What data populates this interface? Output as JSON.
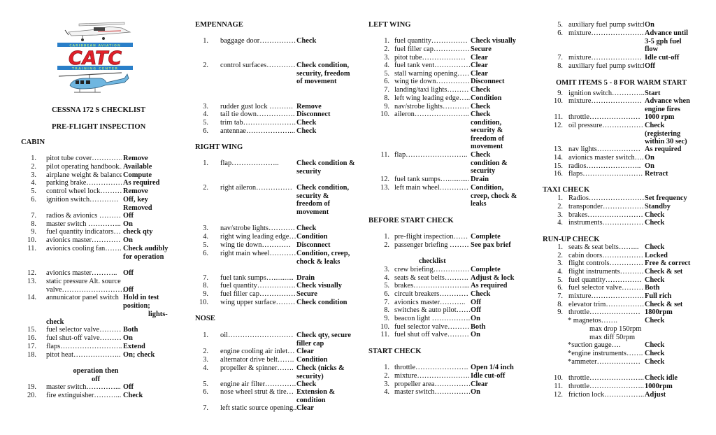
{
  "header": {
    "logo_top_text": "CARIBBEAN AVIATION",
    "logo_main_text": "CATC",
    "logo_bottom_text": "TRAINING CENTER",
    "logo_colors": {
      "red": "#e0202a",
      "blue": "#2a7fc9",
      "heli_blue": "#6fb6e0"
    },
    "title": "CESSNA 172 S CHECKLIST",
    "subtitle": "PRE-FLIGHT INSPECTION"
  },
  "cabin": {
    "title": "CABIN",
    "items": [
      {
        "n": "1.",
        "label": "pitot tube cover………….",
        "value": "Remove"
      },
      {
        "n": "2.",
        "label": "pilot operating handbook..",
        "value": "Available"
      },
      {
        "n": "3.",
        "label": "airplane weight & balance.",
        "value": "Compute"
      },
      {
        "n": "4.",
        "label": "parking brake……………",
        "value": "As required"
      },
      {
        "n": "5.",
        "label": "control wheel lock………",
        "value": "Remove"
      },
      {
        "n": "6.",
        "label": "ignition switch…………",
        "value": "Off, key Removed"
      },
      {
        "n": "7.",
        "label": "radios & avionics ………",
        "value": "Off"
      },
      {
        "n": "8.",
        "label": "master switch …………..",
        "value": "On"
      },
      {
        "n": "9.",
        "label": "fuel quantity indicators…",
        "value": "check qty"
      },
      {
        "n": "10.",
        "label": "avionics master…………",
        "value": "On"
      },
      {
        "n": "11.",
        "label": "avionics cooling fan…….",
        "value": "Check audibly for operation"
      },
      {
        "n": "12.",
        "label": "avionics master………..",
        "value": "Off"
      },
      {
        "n": "13.",
        "label": "static pressure Alt. source valve………………………",
        "value": "Off"
      },
      {
        "n": "14.",
        "label": "annunicator panel switch",
        "value": "Hold in test position;"
      },
      {
        "n": "15.",
        "label": "fuel selector valve……….",
        "value": "Both"
      },
      {
        "n": "16.",
        "label": "fuel shut-off valve………",
        "value": "On"
      },
      {
        "n": "17.",
        "label": "flaps……………………..",
        "value": "Extend"
      },
      {
        "n": "18.",
        "label": "pitot heat………………..",
        "value": "On; check"
      },
      {
        "n": "19.",
        "label": "master switch…………...",
        "value": "Off"
      },
      {
        "n": "20.",
        "label": "fire extinguisher………...",
        "value": "Check"
      }
    ],
    "item14_cont1": "lights-",
    "item14_cont2": "check",
    "item18_cont1": "operation then",
    "item18_cont2": "off"
  },
  "empennage": {
    "title": "EMPENNAGE",
    "items": [
      {
        "n": "1.",
        "label": "baggage door……………",
        "value": "Check"
      },
      {
        "n": "2.",
        "label": "control surfaces…………",
        "value": "Check condition, security, freedom of movement"
      },
      {
        "n": "3.",
        "label": "rudder gust lock ……….",
        "value": "Remove"
      },
      {
        "n": "4.",
        "label": "tail tie down…………….",
        "value": "Disconnect"
      },
      {
        "n": "5.",
        "label": "trim tab…………………..",
        "value": "Check"
      },
      {
        "n": "6.",
        "label": "antennae………………...",
        "value": "Check"
      }
    ]
  },
  "right_wing": {
    "title": "RIGHT WING",
    "items": [
      {
        "n": "1.",
        "label": "flap………………..",
        "value": "Check condition & security"
      },
      {
        "n": "2.",
        "label": "right aileron……………",
        "value": "Check condition, security & freedom of movement"
      },
      {
        "n": "3.",
        "label": "nav/strobe lights…………",
        "value": "Check"
      },
      {
        "n": "4.",
        "label": "right wing leading edge…",
        "value": "Condition"
      },
      {
        "n": "5.",
        "label": "wing tie down…………",
        "value": "Disconnect"
      },
      {
        "n": "6.",
        "label": "right main wheel…………",
        "value": "Condition, creep, chock & leaks"
      },
      {
        "n": "7.",
        "label": "fuel tank sumps…...........",
        "value": "Drain"
      },
      {
        "n": "8.",
        "label": "fuel quantity…………….",
        "value": "Check visually"
      },
      {
        "n": "9.",
        "label": "fuel filler cap…………….",
        "value": "Secure"
      },
      {
        "n": "10.",
        "label": "wing upper surface………",
        "value": "Check condition"
      }
    ]
  },
  "nose": {
    "title": "NOSE",
    "items": [
      {
        "n": "1.",
        "label": "oil………………………",
        "value": "Check qty, secure filler cap"
      },
      {
        "n": "2.",
        "label": "engine cooling air inlet…",
        "value": "Clear"
      },
      {
        "n": "3.",
        "label": "alternator drive belt…….",
        "value": "Condition"
      },
      {
        "n": "4.",
        "label": "propeller & spinner…….",
        "value": "Check (nicks & security)"
      },
      {
        "n": "5.",
        "label": "engine air filter………….",
        "value": "Check"
      },
      {
        "n": "6.",
        "label": "nose wheel strut & tire…",
        "value": "Extension & condition"
      },
      {
        "n": "7.",
        "label": "left static source opening...",
        "value": "Clear"
      }
    ]
  },
  "left_wing": {
    "title": "LEFT WING",
    "items": [
      {
        "n": "1.",
        "label": "fuel quantity……………",
        "value": "Check visually"
      },
      {
        "n": "2.",
        "label": "fuel filler cap……………",
        "value": "Secure"
      },
      {
        "n": "3.",
        "label": "pitot tube………………",
        "value": "Clear"
      },
      {
        "n": "4.",
        "label": "fuel tank vent……………",
        "value": "Clear"
      },
      {
        "n": "5.",
        "label": "stall warning opening……",
        "value": "Clear"
      },
      {
        "n": "6.",
        "label": "wing tie down……………",
        "value": "Disconnect"
      },
      {
        "n": "7.",
        "label": "landing/taxi lights………",
        "value": "Check"
      },
      {
        "n": "8.",
        "label": "left wing leading edge…..",
        "value": "Condition"
      },
      {
        "n": "9.",
        "label": "nav/strobe lights…………",
        "value": "Check"
      },
      {
        "n": "10.",
        "label": "aileron…………………..",
        "value": "Check condition, security & freedom of movement"
      },
      {
        "n": "11.",
        "label": "flap……………………..",
        "value": "Check condition & security"
      },
      {
        "n": "12.",
        "label": "fuel tank sumps…............",
        "value": "Drain"
      },
      {
        "n": "13.",
        "label": "left main wheel…………",
        "value": "Condition, creep, chock & leaks"
      }
    ]
  },
  "before_start": {
    "title": "BEFORE START CHECK",
    "items": [
      {
        "n": "1.",
        "label": "pre-flight inspection……",
        "value": "Complete"
      },
      {
        "n": "2.",
        "label": "passenger briefing ………",
        "value": "See pax brief"
      },
      {
        "n": "3.",
        "label": "crew briefing……………",
        "value": "Complete"
      },
      {
        "n": "4.",
        "label": "seats & seat belts……….",
        "value": "Adjust & lock"
      },
      {
        "n": "5.",
        "label": "brakes…………………...",
        "value": "As required"
      },
      {
        "n": "6.",
        "label": "circuit breakers…………",
        "value": "Check"
      },
      {
        "n": "7.",
        "label": "avionics master………..",
        "value": "Off"
      },
      {
        "n": "8.",
        "label": "switches & auto pilot……",
        "value": "Off"
      },
      {
        "n": "9.",
        "label": "beacon light …………….",
        "value": "On"
      },
      {
        "n": "10.",
        "label": "fuel selector valve………",
        "value": "Both"
      },
      {
        "n": "11.",
        "label": "fuel shut off valve………",
        "value": "On"
      }
    ],
    "item2_cont": "checklist"
  },
  "start_check": {
    "title": "START CHECK",
    "items": [
      {
        "n": "1.",
        "label": "throttle………………….",
        "value": "Open 1/4 inch"
      },
      {
        "n": "2.",
        "label": "mixture…………………..",
        "value": "Idle cut-off"
      },
      {
        "n": "3.",
        "label": "propeller area……………",
        "value": "Clear"
      },
      {
        "n": "4.",
        "label": "master switch……………",
        "value": "On"
      },
      {
        "n": "5.",
        "label": "auxiliary fuel pump switch",
        "value": "On"
      },
      {
        "n": "6.",
        "label": "mixture…………………..",
        "value": "Advance until 3-5 gph fuel flow"
      },
      {
        "n": "7.",
        "label": "mixture…………………",
        "value": "Idle cut-off"
      },
      {
        "n": "8.",
        "label": "auxiliary fuel pump switch",
        "value": "Off"
      },
      {
        "n": "9.",
        "label": "ignition switch…………..",
        "value": "Start"
      },
      {
        "n": "10.",
        "label": "mixture…………………",
        "value": "Advance when engine fires"
      },
      {
        "n": "11.",
        "label": "throttle…………………",
        "value": "1000 rpm"
      },
      {
        "n": "12.",
        "label": "oil pressure………………",
        "value": "Check (registering within 30 sec)"
      },
      {
        "n": "13.",
        "label": "nav lights………………",
        "value": "As required"
      },
      {
        "n": "14.",
        "label": "avionics master switch….",
        "value": "On"
      },
      {
        "n": "15.",
        "label": "radios…………………..",
        "value": "On"
      },
      {
        "n": "16.",
        "label": "flaps…………………….",
        "value": "Retract"
      }
    ],
    "omit_note": "OMIT ITEMS 5 - 8 FOR WARM START"
  },
  "taxi_check": {
    "title": "TAXI CHECK",
    "items": [
      {
        "n": "1.",
        "label": "Radios……………………",
        "value": "Set frequency"
      },
      {
        "n": "2.",
        "label": "transponder………………",
        "value": "Standby"
      },
      {
        "n": "3.",
        "label": "brakes……………………",
        "value": "Check"
      },
      {
        "n": "4.",
        "label": "instruments………………",
        "value": "Check"
      }
    ]
  },
  "runup_check": {
    "title": "RUN-UP CHECK",
    "items": [
      {
        "n": "1.",
        "label": "seats & seat belts……...",
        "value": "Check"
      },
      {
        "n": "2.",
        "label": "cabin doors………………",
        "value": "Locked"
      },
      {
        "n": "3.",
        "label": "flight controls……………",
        "value": "Free & correct"
      },
      {
        "n": "4.",
        "label": "flight instruments……….",
        "value": "Check & set"
      },
      {
        "n": "5.",
        "label": "fuel quantity……………",
        "value": "Check"
      },
      {
        "n": "6.",
        "label": "fuel selector valve………",
        "value": "Both"
      },
      {
        "n": "7.",
        "label": "mixture…………………..",
        "value": "Full rich"
      },
      {
        "n": "8.",
        "label": "elevator trim…………….",
        "value": "Check & set"
      },
      {
        "n": "9.",
        "label": "throttle…………………",
        "value": "1800rpm"
      },
      {
        "n": "10.",
        "label": "throttle…………………..",
        "value": "Check idle"
      },
      {
        "n": "11.",
        "label": "throttle…………………...",
        "value": "1000rpm"
      },
      {
        "n": "12.",
        "label": "friction lock……………..",
        "value": "Adjust"
      }
    ],
    "sub": [
      {
        "label": "*   magnetos…….",
        "value": "Check"
      },
      {
        "label": "max drop 150rpm"
      },
      {
        "label": "max diff    50rpm"
      },
      {
        "label": "*suction gauge….",
        "value": "Check"
      },
      {
        "label": "*engine instruments…….",
        "value": "Check"
      },
      {
        "label": "*ammeter………………",
        "value": "Check"
      }
    ]
  }
}
